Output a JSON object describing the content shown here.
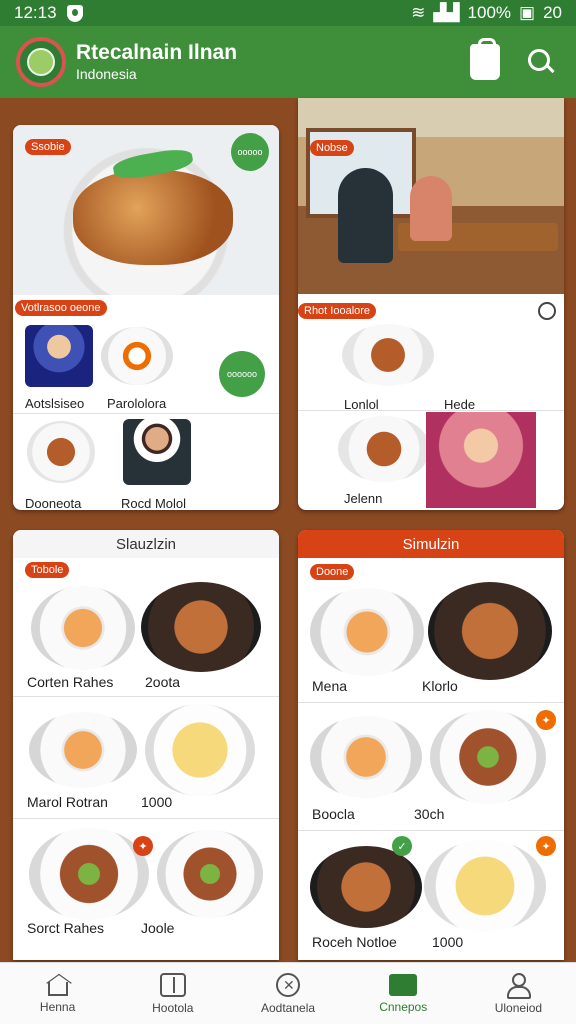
{
  "status_bar": {
    "time": "12:13",
    "battery_text": "100%",
    "signal_extra": "20"
  },
  "app_bar": {
    "title": "Rtecalnain Ilnan",
    "subtitle": "Indonesia"
  },
  "cards": {
    "top_left": {
      "hero_tag": "Ssobie",
      "hero_badge": "ooooo",
      "section_tag": "Votlrasoo oeone",
      "round_badge": "oooooo",
      "items": [
        {
          "caption": "Aotslsiseo"
        },
        {
          "caption": "Parololora"
        },
        {
          "caption": "Dooneota"
        },
        {
          "caption": "Rocd Molol"
        }
      ]
    },
    "top_right": {
      "hero_tag": "Nobse",
      "section_tag": "Rhot Iooalore",
      "items": [
        {
          "caption": "Lonlol"
        },
        {
          "caption": "Hede"
        },
        {
          "caption": "Jelenn"
        }
      ]
    },
    "bottom_left": {
      "title": "Slauzlzin",
      "tag": "Tobole",
      "rows": [
        {
          "name": "Corten Rahes",
          "price": "2oota"
        },
        {
          "name": "Marol Rotran",
          "price": "1000"
        },
        {
          "name": "Sorct Rahes",
          "price": "Joole"
        }
      ]
    },
    "bottom_right": {
      "title": "Simulzin",
      "tag": "Doone",
      "rows": [
        {
          "name": "Mena",
          "price": "Klorlo"
        },
        {
          "name": "Boocla",
          "price": "30ch"
        },
        {
          "name": "Roceh Notloe",
          "price": "1000"
        }
      ]
    }
  },
  "bottom_nav": [
    {
      "label": "Henna",
      "icon": "home-icon"
    },
    {
      "label": "Hootola",
      "icon": "book-icon"
    },
    {
      "label": "Aodtanela",
      "icon": "dish-icon"
    },
    {
      "label": "Cnnepos",
      "icon": "folder-icon",
      "active": true
    },
    {
      "label": "Uloneiod",
      "icon": "user-icon"
    }
  ],
  "colors": {
    "primary": "#3f8f3a",
    "accent": "#d84315",
    "background": "#8b4a22"
  }
}
